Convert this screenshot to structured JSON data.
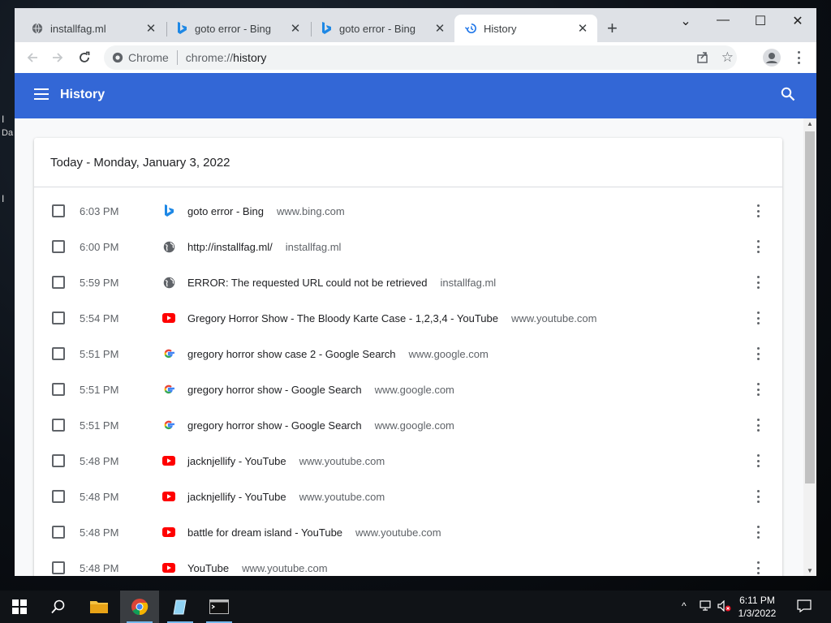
{
  "desktop": {
    "glyphs": [
      "I",
      "Da",
      "I"
    ]
  },
  "tabs": [
    {
      "title": "installfag.ml",
      "icon": "globe-icon",
      "active": false
    },
    {
      "title": "goto error - Bing",
      "icon": "bing-icon",
      "active": false
    },
    {
      "title": "goto error - Bing",
      "icon": "bing-icon",
      "active": false
    },
    {
      "title": "History",
      "icon": "history-icon",
      "active": true
    }
  ],
  "toolbar": {
    "site_label": "Chrome",
    "url_scheme": "chrome://",
    "url_path": "history"
  },
  "header": {
    "title": "History"
  },
  "history": {
    "date_heading": "Today - Monday, January 3, 2022",
    "rows": [
      {
        "time": "6:03 PM",
        "title": "goto error - Bing",
        "domain": "www.bing.com",
        "icon": "bing-icon"
      },
      {
        "time": "6:00 PM",
        "title": "http://installfag.ml/",
        "domain": "installfag.ml",
        "icon": "globe-icon"
      },
      {
        "time": "5:59 PM",
        "title": "ERROR: The requested URL could not be retrieved",
        "domain": "installfag.ml",
        "icon": "globe-icon"
      },
      {
        "time": "5:54 PM",
        "title": "Gregory Horror Show - The Bloody Karte Case - 1,2,3,4 - YouTube",
        "domain": "www.youtube.com",
        "icon": "youtube-icon"
      },
      {
        "time": "5:51 PM",
        "title": "gregory horror show case 2 - Google Search",
        "domain": "www.google.com",
        "icon": "google-icon"
      },
      {
        "time": "5:51 PM",
        "title": "gregory horror show - Google Search",
        "domain": "www.google.com",
        "icon": "google-icon"
      },
      {
        "time": "5:51 PM",
        "title": "gregory horror show - Google Search",
        "domain": "www.google.com",
        "icon": "google-icon"
      },
      {
        "time": "5:48 PM",
        "title": "jacknjellify - YouTube",
        "domain": "www.youtube.com",
        "icon": "youtube-icon"
      },
      {
        "time": "5:48 PM",
        "title": "jacknjellify - YouTube",
        "domain": "www.youtube.com",
        "icon": "youtube-icon"
      },
      {
        "time": "5:48 PM",
        "title": "battle for dream island - YouTube",
        "domain": "www.youtube.com",
        "icon": "youtube-icon"
      },
      {
        "time": "5:48 PM",
        "title": "YouTube",
        "domain": "www.youtube.com",
        "icon": "youtube-icon"
      }
    ]
  },
  "taskbar": {
    "time": "6:11 PM",
    "date": "1/3/2022"
  },
  "colors": {
    "header": "#3367d6",
    "tabstrip": "#dee1e6",
    "taskbar": "#101317"
  }
}
